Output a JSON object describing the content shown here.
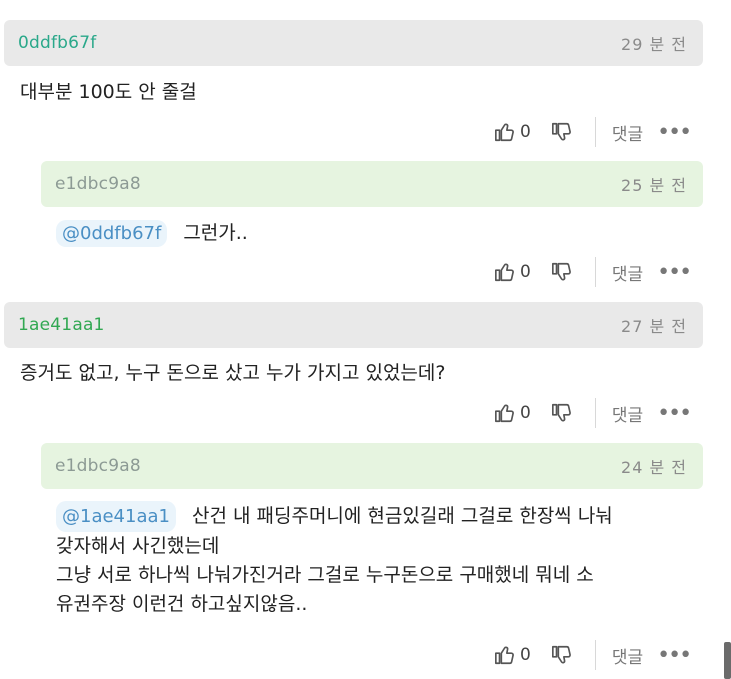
{
  "comments": [
    {
      "user": "0ddfb67f",
      "time": "29 분 전",
      "text": "대부분 100도 안 줄걸",
      "likes": "0",
      "reply_label": "댓글"
    },
    {
      "user": "e1dbc9a8",
      "time": "25 분 전",
      "mention": "@0ddfb67f",
      "text": "그런가..",
      "likes": "0",
      "reply_label": "댓글"
    },
    {
      "user": "1ae41aa1",
      "time": "27 분 전",
      "text": "증거도 없고, 누구 돈으로 샀고 누가 가지고 있었는데?",
      "likes": "0",
      "reply_label": "댓글"
    },
    {
      "user": "e1dbc9a8",
      "time": "24 분 전",
      "mention": "@1ae41aa1",
      "text_line1": "산건 내 패딩주머니에 현금있길래 그걸로 한장씩 나눠",
      "text_line2": "갖자해서 사긴했는데",
      "text_line3": "그냥 서로 하나씩 나눠가진거라 그걸로 누구돈으로 구매했네 뭐네 소",
      "text_line4": "유권주장 이런건 하고싶지않음..",
      "likes": "0",
      "reply_label": "댓글"
    }
  ],
  "icons": {
    "like": "thumbs-up-icon",
    "dislike": "thumbs-down-icon",
    "more": "more-dots-icon"
  },
  "colors": {
    "header_gray": "#e9e9e9",
    "header_green": "#e6f4e0",
    "mention_bg": "#eaf4fb",
    "mention_text": "#4a8fc4"
  }
}
